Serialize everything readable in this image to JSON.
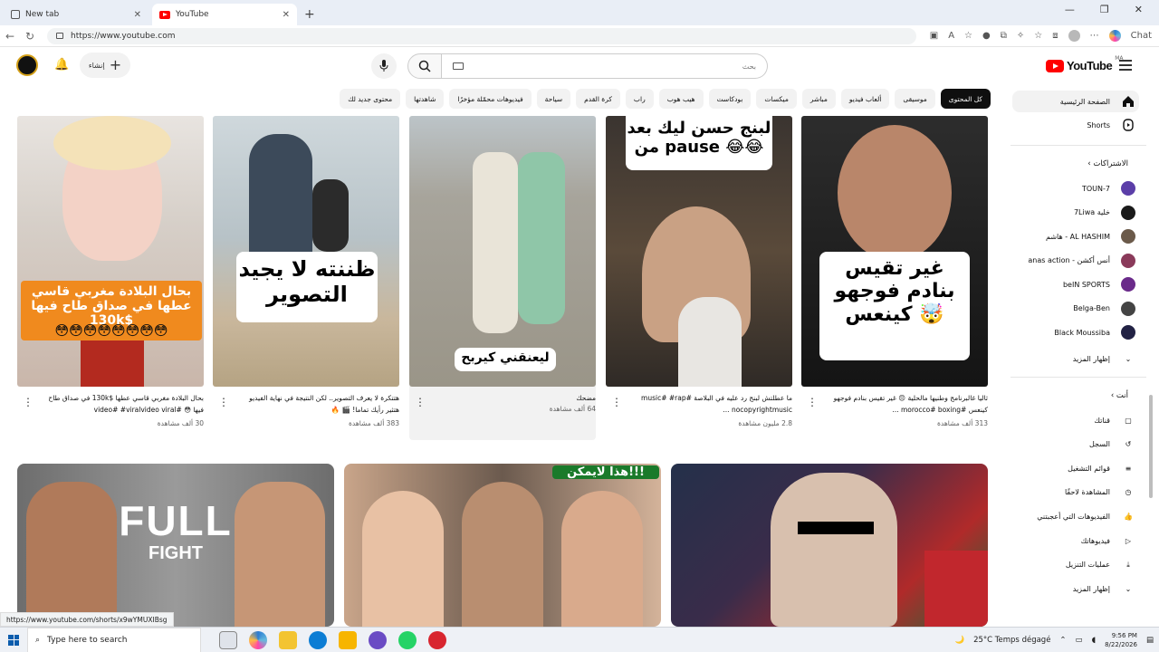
{
  "browser": {
    "tabs": [
      {
        "title": "New tab",
        "active": false
      },
      {
        "title": "YouTube",
        "active": true
      }
    ],
    "url": "https://www.youtube.com",
    "chat_label": "Chat"
  },
  "header": {
    "create_label": "إنشاء",
    "search_placeholder": "بحث",
    "logo_text": "YouTube",
    "country_code": "MA"
  },
  "chips": [
    "كل المحتوى",
    "موسيقى",
    "ألعاب فيديو",
    "مباشر",
    "ميكسات",
    "بودكاست",
    "هيب هوب",
    "راب",
    "كرة القدم",
    "سياحة",
    "فيديوهات محمّلة مؤخرًا",
    "شاهدتها",
    "محتوى جديد لك"
  ],
  "shorts": [
    {
      "title": "بحال البلادة مغربي قاسي عطها $130k في صداق طاح فيها 😳 #video# #viralvideo viral",
      "views": "30 ألف مشاهدة",
      "caption": "بحال البلادة مغربي قاسي عطها في صداق طاح فيها 130k$",
      "emoji": "😳😳😳😳😳😳😳😳"
    },
    {
      "title": "هتتكرة لا يعرف التصوير.. لكن النتيجة في نهاية الفيديو هتثير رأيك تماما! 🎬 🔥",
      "views": "383 ألف مشاهدة",
      "caption": "ظننته لا يجيد التصوير"
    },
    {
      "title": "مضحك",
      "views": "64 ألف مشاهدة",
      "caption": "ليعنقني كيربح"
    },
    {
      "title": "ما عطلتش لبنج رد عليه في البلاصة #music# #rap nocopyrightmusic ...",
      "views": "2.8 مليون مشاهدة",
      "caption": "لبنج حسن ليك بعد من pause 😂😂"
    },
    {
      "title": "ثاليا غالبرنامج وطنيها مالحلية 😔 غير تقيس بنادم فوجهو كينعس #morocco# boxing ...",
      "views": "313 ألف مشاهدة",
      "caption": "غير تقيس بنادم فوجهو كينعس 🤯"
    }
  ],
  "videos": [
    {
      "overlay_title": "FULL",
      "overlay_sub": "FIGHT"
    },
    {
      "overlay_title": "هذا لايمكن!!!"
    },
    {
      "overlay_title": ""
    }
  ],
  "sidebar": {
    "home": "الصفحة الرئيسية",
    "shorts": "Shorts",
    "subscriptions": "الاشتراكات",
    "channels": [
      {
        "name": "7-TOUN",
        "color": "#5b3ea8"
      },
      {
        "name": "خلية 7Liwa",
        "color": "#1a1a1a"
      },
      {
        "name": "AL HASHIM - هاشم",
        "color": "#6b5a4a"
      },
      {
        "name": "أنس أكشن - anas action",
        "color": "#8a3a5a"
      },
      {
        "name": "beIN SPORTS",
        "color": "#6a2a8a"
      },
      {
        "name": "Belga-Ben",
        "color": "#444444"
      },
      {
        "name": "Black Moussiba",
        "color": "#222244"
      }
    ],
    "show_more": "إظهار المزيد",
    "you": "أنت",
    "you_items": [
      "قناتك",
      "السجل",
      "قوائم التشغيل",
      "المشاهدة لاحقًا",
      "الفيديوهات التي أعجبتني",
      "فيديوهاتك",
      "عمليات التنزيل",
      "إظهار المزيد"
    ]
  },
  "status_url": "https://www.youtube.com/shorts/x9wYMUXIBsg",
  "taskbar": {
    "search_placeholder": "Type here to search",
    "weather": "25°C  Temps dégagé",
    "time": "9:56 PM",
    "date": "8/22/2026"
  }
}
